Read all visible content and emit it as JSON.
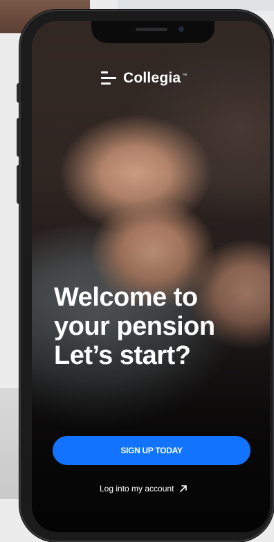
{
  "app": {
    "brand_name": "Collegia",
    "brand_tm": "™"
  },
  "welcome": {
    "line1": "Welcome to",
    "line2": "your pension",
    "line3": "Let’s start?"
  },
  "actions": {
    "signup_label": "SIGN UP TODAY",
    "login_label": "Log into my account"
  },
  "icons": {
    "logo": "collegia-logo-icon",
    "login_arrow": "arrow-up-right-icon"
  },
  "colors": {
    "primary": "#1273ff",
    "text": "#ffffff"
  }
}
